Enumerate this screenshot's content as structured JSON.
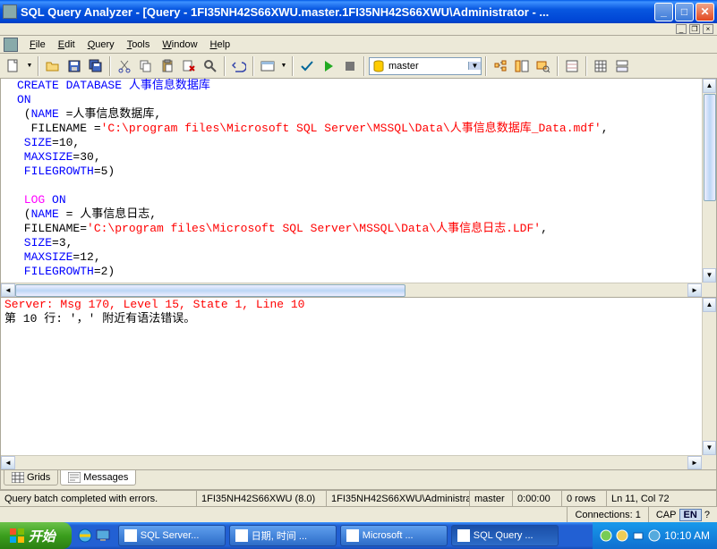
{
  "title": "SQL Query Analyzer - [Query - 1FI35NH42S66XWU.master.1FI35NH42S66XWU\\Administrator - ...",
  "menu": {
    "file": "File",
    "edit": "Edit",
    "query": "Query",
    "tools": "Tools",
    "window": "Window",
    "help": "Help"
  },
  "dbselect": "master",
  "sql": {
    "l1a": "CREATE DATABASE",
    "l1b": " 人事信息数据库",
    "l2": "ON",
    "l3a": " (",
    "l3b": "NAME",
    "l3c": " =人事信息数据库,",
    "l4a": "  FILENAME =",
    "l4b": "'C:\\program files\\Microsoft SQL Server\\MSSQL\\Data\\人事信息数据库_Data.mdf'",
    "l4c": ",",
    "l5a": " SIZE",
    "l5b": "=10,",
    "l6a": " MAXSIZE",
    "l6b": "=30,",
    "l7a": " FILEGROWTH",
    "l7b": "=5)",
    "l8": "",
    "l9a": " LOG",
    "l9b": " ON",
    "l10a": " (",
    "l10b": "NAME",
    "l10c": " = 人事信息日志,",
    "l11a": " FILENAME=",
    "l11b": "'C:\\program files\\Microsoft SQL Server\\MSSQL\\Data\\人事信息日志.LDF'",
    "l11c": ",",
    "l12a": " SIZE",
    "l12b": "=3,",
    "l13a": " MAXSIZE",
    "l13b": "=12,",
    "l14a": " FILEGROWTH",
    "l14b": "=2)"
  },
  "results": {
    "l1": "Server: Msg 170, Level 15, State 1, Line 10",
    "l2": "第 10 行: '，' 附近有语法错误。"
  },
  "tabs": {
    "grids": "Grids",
    "messages": "Messages"
  },
  "status": {
    "msg": "Query batch completed with errors.",
    "server": "1FI35NH42S66XWU (8.0)",
    "user": "1FI35NH42S66XWU\\Administra",
    "db": "master",
    "time": "0:00:00",
    "rows": "0 rows",
    "pos": "Ln 11, Col 72"
  },
  "status2": {
    "conn": "Connections: 1",
    "caps": "CAP",
    "lang": "EN"
  },
  "taskbar": {
    "start": "开始",
    "t1": "SQL Server...",
    "t2": "日期, 时间 ...",
    "t3": "Microsoft ...",
    "t4": "SQL Query ...",
    "clock": "10:10 AM"
  }
}
